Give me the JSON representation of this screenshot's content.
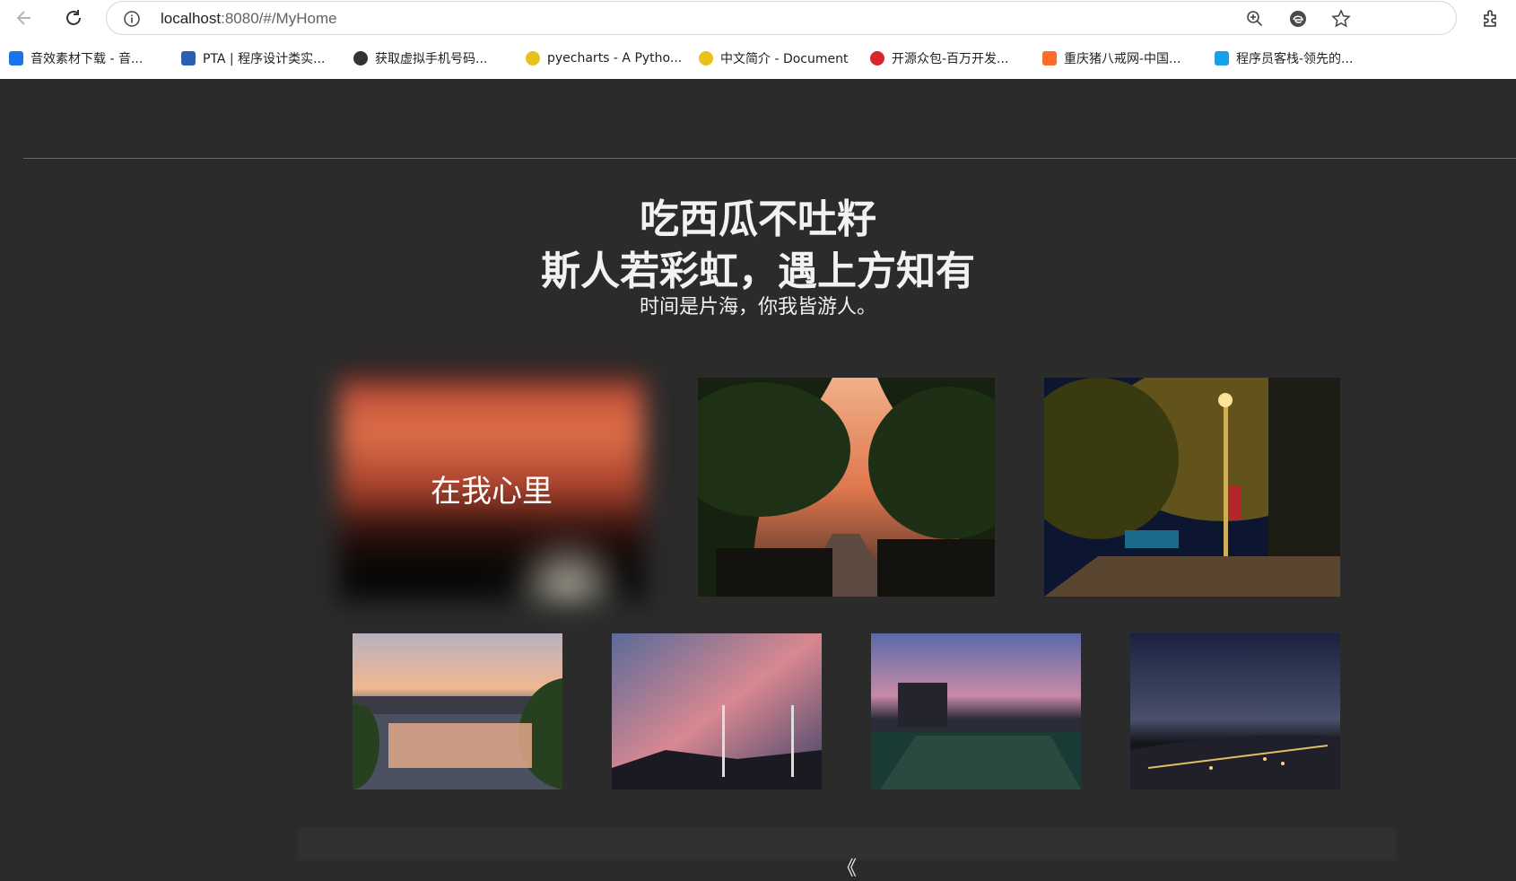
{
  "browser": {
    "url_host": "localhost",
    "url_path": ":8080/#/MyHome",
    "icons": [
      "back-arrow-icon",
      "reload-icon",
      "info-icon",
      "zoom-icon",
      "edge-icon",
      "star-icon",
      "extensions-icon"
    ]
  },
  "bookmarks": [
    {
      "label": "音效素材下载 - 音...",
      "color": "#1a73e8"
    },
    {
      "label": "PTA | 程序设计类实...",
      "color": "#2b5fb4"
    },
    {
      "label": "获取虚拟手机号码...",
      "color": "#333333"
    },
    {
      "label": "pyecharts - A Pytho...",
      "color": "#e8c21a"
    },
    {
      "label": "中文简介 - Document",
      "color": "#e8c21a"
    },
    {
      "label": "开源众包-百万开发...",
      "color": "#d9262b"
    },
    {
      "label": "重庆猪八戒网-中国...",
      "color": "#ff6a2c"
    },
    {
      "label": "程序员客栈-领先的...",
      "color": "#1aa0e8"
    }
  ],
  "hero": {
    "title_line1": "吃西瓜不吐籽",
    "title_line2": "斯人若彩虹，遇上方知有",
    "subtitle": "时间是片海，你我皆游人。"
  },
  "gallery": {
    "featured_caption": "在我心里"
  },
  "footer": {
    "text": "《"
  }
}
